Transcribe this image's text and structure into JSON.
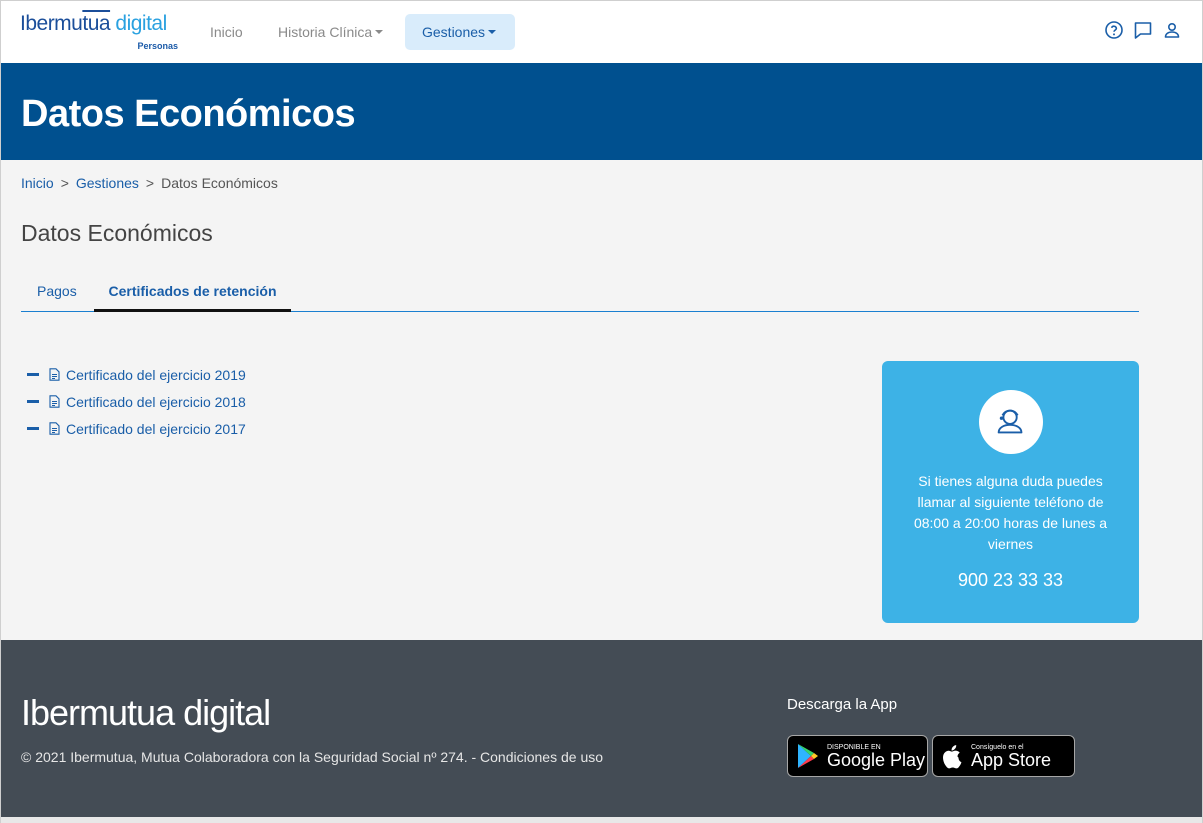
{
  "brand": {
    "logo_part1": "Ibermu",
    "logo_part2": "tua",
    "logo_part3": " digital",
    "logo_sub": "Personas"
  },
  "nav": {
    "inicio": "Inicio",
    "historia": "Historia Clínica",
    "gestiones": "Gestiones",
    "icons": [
      "help-icon",
      "chat-icon",
      "user-icon"
    ]
  },
  "hero": {
    "title": "Datos Económicos"
  },
  "breadcrumb": {
    "items": [
      "Inicio",
      "Gestiones",
      "Datos Económicos"
    ],
    "separator": ">"
  },
  "page": {
    "title": "Datos Económicos"
  },
  "tabs": [
    {
      "label": "Pagos",
      "active": false
    },
    {
      "label": "Certificados de retención",
      "active": true
    }
  ],
  "certificates": [
    "Certificado del ejercicio 2019",
    "Certificado del ejercicio 2018",
    "Certificado del ejercicio 2017"
  ],
  "help": {
    "text": "Si tienes alguna duda puedes llamar al siguiente teléfono de 08:00 a 20:00 horas de lunes a viernes",
    "phone": "900 23 33 33"
  },
  "footer": {
    "logo": "Ibermutua digital",
    "copyright": "© 2021 Ibermutua, Mutua Colaboradora con la Seguridad Social nº 274. - Condiciones de uso",
    "download_label": "Descarga la App",
    "google": {
      "small": "DISPONIBLE EN",
      "big": "Google Play"
    },
    "apple": {
      "small": "Consíguelo en el",
      "big": "App Store"
    }
  },
  "colors": {
    "hero_bg": "#00508f",
    "link": "#1a5ea8",
    "help_bg": "#3db2e6",
    "footer_bg": "#444c55",
    "active_nav_bg": "#d9ecfb"
  }
}
